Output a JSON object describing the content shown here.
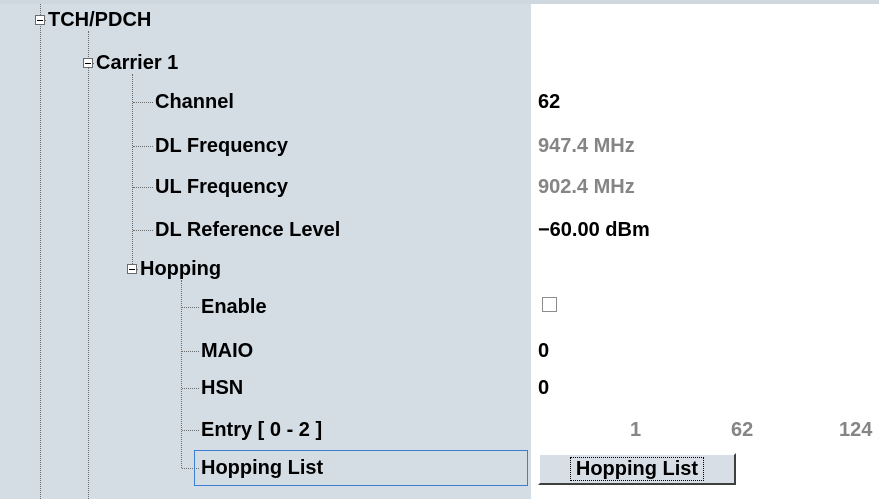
{
  "tree": {
    "root": "TCH/PDCH",
    "carrier": "Carrier 1",
    "channel_label": "Channel",
    "dl_freq_label": "DL Frequency",
    "ul_freq_label": "UL Frequency",
    "dl_ref_label": "DL Reference Level",
    "hopping": "Hopping",
    "enable_label": "Enable",
    "maio_label": "MAIO",
    "hsn_label": "HSN",
    "entry_label": "Entry [ 0 - 2 ]",
    "hopping_list_label": "Hopping List"
  },
  "values": {
    "channel": "62",
    "dl_freq": "947.4 MHz",
    "ul_freq": "902.4 MHz",
    "dl_ref": "−60.00 dBm",
    "enable_checked": false,
    "maio": "0",
    "hsn": "0",
    "entries": [
      "1",
      "62",
      "124"
    ],
    "hopping_list_button": "Hopping List"
  }
}
